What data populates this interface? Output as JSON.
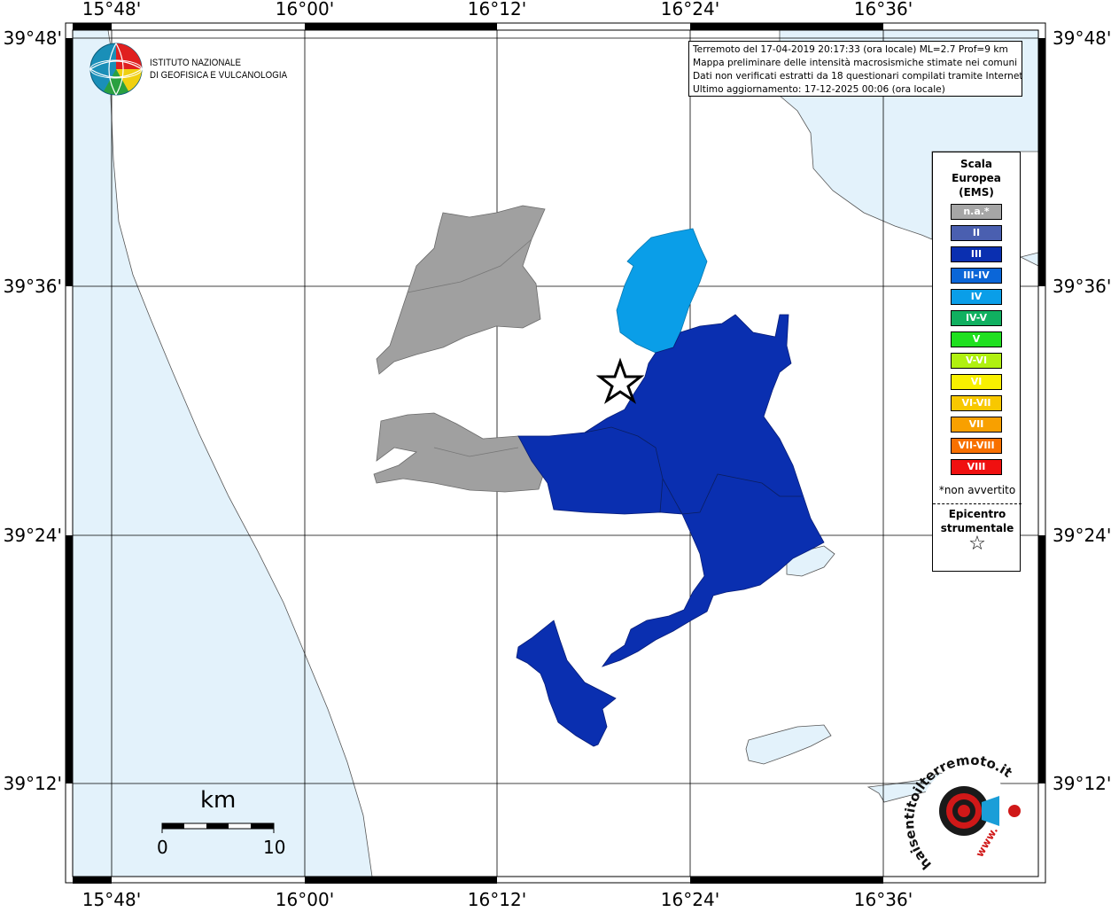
{
  "map": {
    "coordinates": {
      "top_longitudes": [
        "15°48'",
        "16°00'",
        "16°12'",
        "16°24'",
        "16°36'"
      ],
      "bottom_longitudes": [
        "15°48'",
        "16°00'",
        "16°12'",
        "16°24'",
        "16°36'"
      ],
      "left_latitudes": [
        "39°48'",
        "39°36'",
        "39°24'",
        "39°12'"
      ],
      "right_latitudes": [
        "39°48'",
        "39°36'",
        "39°24'",
        "39°12'"
      ]
    },
    "colors": {
      "sea": "#e3f2fb",
      "land": "#ffffff",
      "not_available": "#a0a0a0",
      "intensity_III": "#0a2fb0",
      "intensity_IV": "#0a9ee8"
    }
  },
  "institute": {
    "name_line1": "ISTITUTO NAZIONALE",
    "name_line2": "DI GEOFISICA E VULCANOLOGIA"
  },
  "info": {
    "line1": "Terremoto del 17-04-2019 20:17:33 (ora locale) ML=2.7 Prof=9 km",
    "line2": "Mappa preliminare delle intensità macrosismiche stimate nei comuni",
    "line3": "Dati non verificati estratti da 18 questionari compilati tramite Internet.",
    "line4": "Ultimo aggiornamento: 17-12-2025 00:06 (ora locale)"
  },
  "legend": {
    "title_line1": "Scala",
    "title_line2": "Europea",
    "title_line3": "(EMS)",
    "items": [
      {
        "label": "n.a.*",
        "color": "#a6a6a6"
      },
      {
        "label": "II",
        "color": "#4a5fb0"
      },
      {
        "label": "III",
        "color": "#0a2fb0"
      },
      {
        "label": "III-IV",
        "color": "#0a66d8"
      },
      {
        "label": "IV",
        "color": "#0a9ee8"
      },
      {
        "label": "IV-V",
        "color": "#10b060"
      },
      {
        "label": "V",
        "color": "#20e020"
      },
      {
        "label": "V-VI",
        "color": "#b0f010"
      },
      {
        "label": "VI",
        "color": "#f8f000"
      },
      {
        "label": "VI-VII",
        "color": "#f8c800"
      },
      {
        "label": "VII",
        "color": "#f8a000"
      },
      {
        "label": "VII-VIII",
        "color": "#f87000"
      },
      {
        "label": "VIII",
        "color": "#f01010"
      }
    ],
    "note": "*non avvertito",
    "epicenter_line1": "Epicentro",
    "epicenter_line2": "strumentale",
    "epicenter_symbol": "☆"
  },
  "scalebar": {
    "unit": "km",
    "start": "0",
    "end": "10"
  },
  "watermark": {
    "text": "haisentitoilterremoto.it",
    "url_text": "www."
  }
}
